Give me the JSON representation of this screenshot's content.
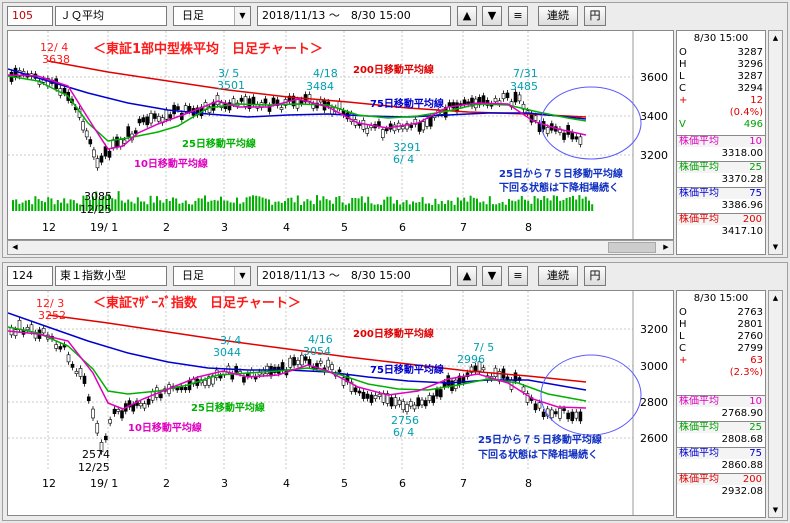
{
  "panels": [
    {
      "code": "105",
      "name": "ＪＱ平均",
      "period": "日足",
      "range": "2018/11/13 ～　8/30 15:00",
      "buttons": {
        "up": "▲",
        "down": "▼",
        "menu": "≡",
        "renzoku": "連続",
        "yen": "円"
      },
      "chart_title": "＜東証1部中型株平均　日足チャート＞",
      "annotations": {
        "a1_date": "12/ 4",
        "a1_val": "3638",
        "a2_date": "3/ 5",
        "a2_val": "3501",
        "a3_date": "4/18",
        "a3_val": "3484",
        "a4_date": "7/31",
        "a4_val": "3485",
        "a5_val": "3291",
        "a5_date": "6/ 4",
        "a6_val": "3085",
        "a6_date": "12/25",
        "ma200": "200日移動平均線",
        "ma75": "75日移動平均線",
        "ma25": "25日移動平均線",
        "ma10": "10日移動平均線",
        "note1": "25日から７５日移動平均線",
        "note2": "下回る状態は下降相場続く"
      },
      "y_ticks": [
        "3600",
        "3400",
        "3200"
      ],
      "x_labels": [
        "12",
        "19/ 1",
        "2",
        "3",
        "4",
        "5",
        "6",
        "7",
        "8"
      ],
      "side": {
        "datetime": "8/30 15:00",
        "o": "3287",
        "h": "3296",
        "l": "3287",
        "c": "3294",
        "chg": "12",
        "pct": "(0.4%)",
        "v": "496",
        "ma": [
          {
            "label": "株価平均",
            "n": "10",
            "value": "3318.00"
          },
          {
            "label": "株価平均",
            "n": "25",
            "value": "3370.28"
          },
          {
            "label": "株価平均",
            "n": "75",
            "value": "3386.96"
          },
          {
            "label": "株価平均",
            "n": "200",
            "value": "3417.10"
          }
        ]
      }
    },
    {
      "code": "124",
      "name": "東１指数小型",
      "period": "日足",
      "range": "2018/11/13 ～　8/30 15:00",
      "buttons": {
        "up": "▲",
        "down": "▼",
        "menu": "≡",
        "renzoku": "連続",
        "yen": "円"
      },
      "chart_title": "＜東証ﾏｻﾞｰｽﾞ指数　日足チャート＞",
      "annotations": {
        "a1_date": "12/ 3",
        "a1_val": "3252",
        "a2_date": "3/ 4",
        "a2_val": "3044",
        "a3_date": "4/16",
        "a3_val": "3054",
        "a4_date": "7/ 5",
        "a4_val": "2996",
        "a5_val": "2756",
        "a5_date": "6/ 4",
        "a6_val": "2574",
        "a6_date": "12/25",
        "ma200": "200日移動平均線",
        "ma75": "75日移動平均線",
        "ma25": "25日移動平均線",
        "ma10": "10日移動平均線",
        "note1": "25日から７５日移動平均線",
        "note2": "下回る状態は下降相場続く"
      },
      "y_ticks": [
        "3200",
        "3000",
        "2800",
        "2600"
      ],
      "x_labels": [
        "12",
        "19/ 1",
        "2",
        "3",
        "4",
        "5",
        "6",
        "7",
        "8"
      ],
      "side": {
        "datetime": "8/30 15:00",
        "o": "2763",
        "h": "2801",
        "l": "2760",
        "c": "2799",
        "chg": "63",
        "pct": "(2.3%)",
        "v": "",
        "ma": [
          {
            "label": "株価平均",
            "n": "10",
            "value": "2768.90"
          },
          {
            "label": "株価平均",
            "n": "25",
            "value": "2808.68"
          },
          {
            "label": "株価平均",
            "n": "75",
            "value": "2860.88"
          },
          {
            "label": "株価平均",
            "n": "200",
            "value": "2932.08"
          }
        ]
      }
    }
  ],
  "colors": {
    "title": "#ff1a1a",
    "ma200": "#e00000",
    "ma75": "#0000d0",
    "ma25": "#00b000",
    "ma10": "#e000c0",
    "annot": "#00a0b0",
    "note": "#1030c0",
    "volume": "#00b000",
    "circle": "#5a5aff"
  }
}
